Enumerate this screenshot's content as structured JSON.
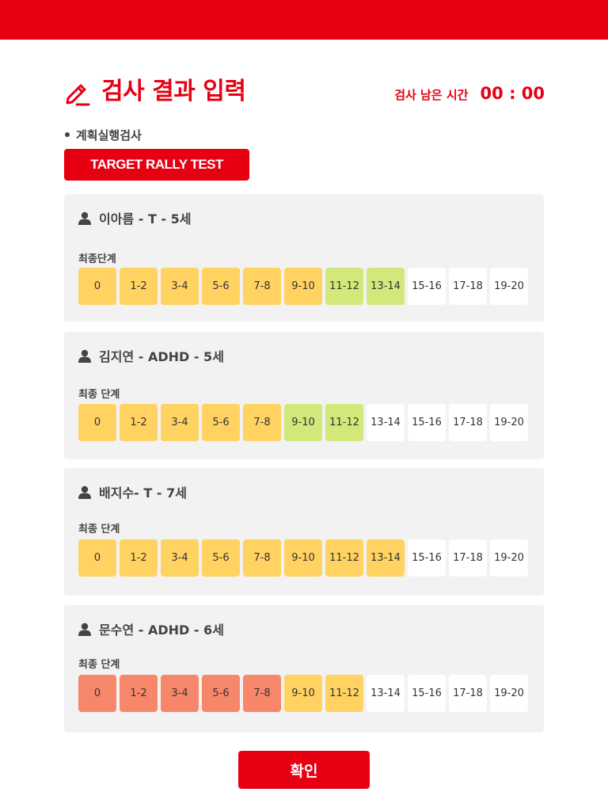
{
  "header": {
    "title": "검사 결과 입력",
    "timer_label": "검사 남은 시간",
    "timer_value": "00 : 00"
  },
  "section": {
    "label": "계획실행검사",
    "test_button": "TARGET RALLY TEST"
  },
  "colors": {
    "brand": "#e60012",
    "yellow": "#ffd262",
    "green": "#d2e87a",
    "salmon": "#f7876a",
    "white": "#ffffff"
  },
  "levels": [
    "0",
    "1-2",
    "3-4",
    "5-6",
    "7-8",
    "9-10",
    "11-12",
    "13-14",
    "15-16",
    "17-18",
    "19-20"
  ],
  "results": [
    {
      "name": "이아름 - T - 5세",
      "sub_label": "최종단계",
      "level_states": [
        "yellow",
        "yellow",
        "yellow",
        "yellow",
        "yellow",
        "yellow",
        "green",
        "green",
        "white",
        "white",
        "white"
      ]
    },
    {
      "name": "김지연  -  ADHD  -  5세",
      "sub_label": "최종 단계",
      "level_states": [
        "yellow",
        "yellow",
        "yellow",
        "yellow",
        "yellow",
        "green",
        "green",
        "white",
        "white",
        "white",
        "white"
      ]
    },
    {
      "name": "배지수- T - 7세",
      "sub_label": "최종 단계",
      "level_states": [
        "yellow",
        "yellow",
        "yellow",
        "yellow",
        "yellow",
        "yellow",
        "yellow",
        "yellow",
        "white",
        "white",
        "white"
      ]
    },
    {
      "name": "문수연 - ADHD - 6세",
      "sub_label": "최종 단계",
      "level_states": [
        "salmon",
        "salmon",
        "salmon",
        "salmon",
        "salmon",
        "yellow",
        "yellow",
        "white",
        "white",
        "white",
        "white"
      ]
    }
  ],
  "confirm_label": "확인"
}
